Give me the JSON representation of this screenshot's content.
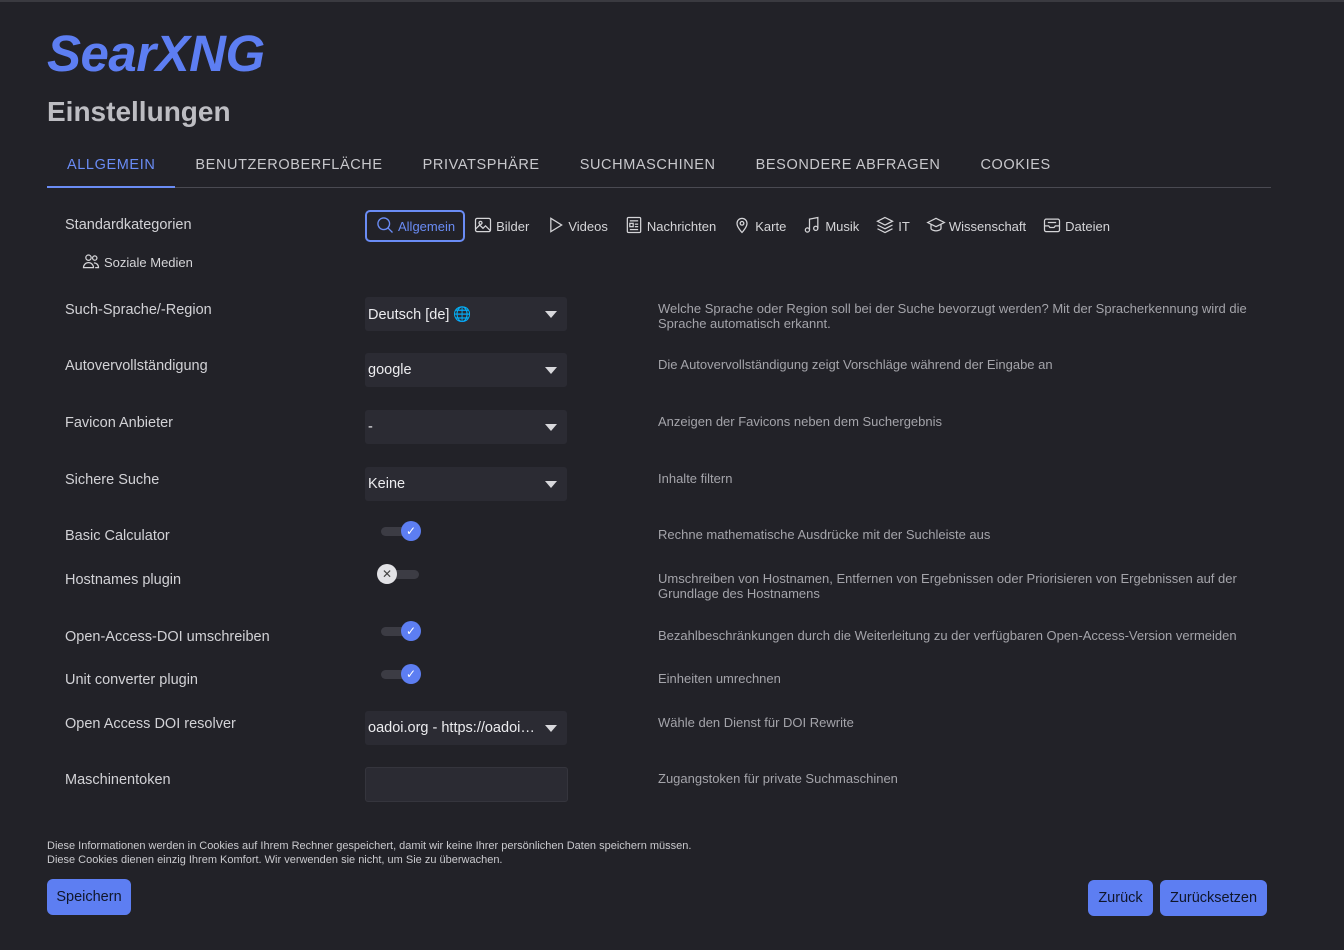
{
  "logo": "SearXNG",
  "page_title": "Einstellungen",
  "tabs": [
    {
      "label": "ALLGEMEIN",
      "active": true
    },
    {
      "label": "BENUTZEROBERFLÄCHE"
    },
    {
      "label": "PRIVATSPHÄRE"
    },
    {
      "label": "SUCHMASCHINEN"
    },
    {
      "label": "BESONDERE ABFRAGEN"
    },
    {
      "label": "COOKIES"
    }
  ],
  "categories": {
    "label": "Standardkategorien",
    "items": [
      {
        "label": "Allgemein",
        "icon": "search-icon",
        "active": true
      },
      {
        "label": "Bilder",
        "icon": "image-icon"
      },
      {
        "label": "Videos",
        "icon": "play-icon"
      },
      {
        "label": "Nachrichten",
        "icon": "newspaper-icon"
      },
      {
        "label": "Karte",
        "icon": "map-pin-icon"
      },
      {
        "label": "Musik",
        "icon": "music-note-icon"
      },
      {
        "label": "IT",
        "icon": "layers-icon"
      },
      {
        "label": "Wissenschaft",
        "icon": "graduation-cap-icon"
      },
      {
        "label": "Dateien",
        "icon": "archive-icon"
      },
      {
        "label": "Soziale Medien",
        "icon": "people-icon"
      }
    ]
  },
  "settings": {
    "language": {
      "label": "Such-Sprache/-Region",
      "value": "Deutsch [de] 🌐",
      "desc": "Welche Sprache oder Region soll bei der Suche bevorzugt werden? Mit der Spracherkennung wird die Sprache automatisch erkannt."
    },
    "autocomplete": {
      "label": "Autovervollständigung",
      "value": "google",
      "desc": "Die Autovervollständigung zeigt Vorschläge während der Eingabe an"
    },
    "favicon": {
      "label": "Favicon Anbieter",
      "value": "-",
      "desc": "Anzeigen der Favicons neben dem Suchergebnis"
    },
    "safesearch": {
      "label": "Sichere Suche",
      "value": "Keine",
      "desc": "Inhalte filtern"
    },
    "calculator": {
      "label": "Basic Calculator",
      "enabled": true,
      "knob": "✓",
      "desc": "Rechne mathematische Ausdrücke mit der Suchleiste aus"
    },
    "hostnames": {
      "label": "Hostnames plugin",
      "enabled": false,
      "knob": "✕",
      "desc": "Umschreiben von Hostnamen, Entfernen von Ergebnissen oder Priorisieren von Ergebnissen auf der Grundlage des Hostnamens"
    },
    "oadoi": {
      "label": "Open-Access-DOI umschreiben",
      "enabled": true,
      "knob": "✓",
      "desc": "Bezahlbeschränkungen durch die Weiterleitung zu der verfügbaren Open-Access-Version vermeiden"
    },
    "unit_converter": {
      "label": "Unit converter plugin",
      "enabled": true,
      "knob": "✓",
      "desc": "Einheiten umrechnen"
    },
    "doi_resolver": {
      "label": "Open Access DOI resolver",
      "value": "oadoi.org - https://oadoi.org/",
      "desc": "Wähle den Dienst für DOI Rewrite"
    },
    "token": {
      "label": "Maschinentoken",
      "value": "",
      "desc": "Zugangstoken für private Suchmaschinen"
    }
  },
  "notice": {
    "line1": "Diese Informationen werden in Cookies auf Ihrem Rechner gespeichert, damit wir keine Ihrer persönlichen Daten speichern müssen.",
    "line2": "Diese Cookies dienen einzig Ihrem Komfort. Wir verwenden sie nicht, um Sie zu überwachen."
  },
  "buttons": {
    "save": "Speichern",
    "back": "Zurück",
    "reset": "Zurücksetzen"
  },
  "colors": {
    "accent": "#5d7ef2",
    "background": "#222228",
    "input_bg": "#2b2b33"
  }
}
